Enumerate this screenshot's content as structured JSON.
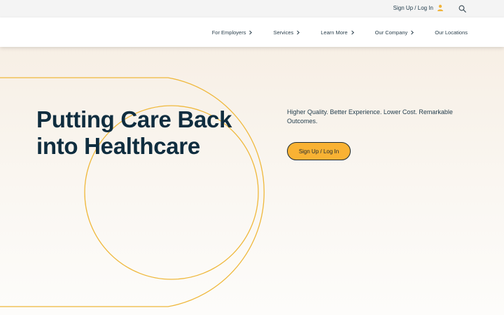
{
  "header": {
    "signup_label": "Sign Up / Log In",
    "icons": {
      "user": "user-icon",
      "search": "search-icon"
    }
  },
  "nav": {
    "items": [
      {
        "label": "For Employers",
        "has_chevron": true
      },
      {
        "label": "Services",
        "has_chevron": true
      },
      {
        "label": "Learn More",
        "has_chevron": true
      },
      {
        "label": "Our Company",
        "has_chevron": true
      },
      {
        "label": "Our Locations",
        "has_chevron": false
      }
    ]
  },
  "hero": {
    "title_line1": "Putting Care Back",
    "title_line2": "into Healthcare",
    "subtitle": "Higher Quality. Better Experience. Lower Cost. Remarkable Outcomes.",
    "cta_label": "Sign Up / Log In"
  },
  "colors": {
    "accent": "#f9b233",
    "heading": "#0f2d3f",
    "text": "#1f3a4a",
    "hero_bg": "#f7efe5",
    "outline": "#efb83b"
  }
}
